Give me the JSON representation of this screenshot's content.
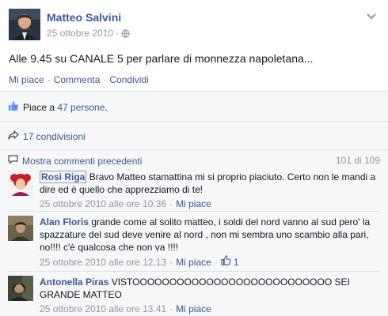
{
  "post": {
    "author": "Matteo Salvini",
    "date": "25 ottobre 2010",
    "message": "Alle 9.45 su CANALE 5 per parlare di monnezza napoletana...",
    "actions": [
      "Mi piace",
      "Commenta",
      "Condividi"
    ]
  },
  "likes": {
    "prefix": "Piace a ",
    "count": "47 persone",
    "suffix": "."
  },
  "shares": {
    "text": "17 condivisioni"
  },
  "comments_header": {
    "link": "Mostra commenti precedenti",
    "count": "101 di 109"
  },
  "comments": [
    {
      "name": "Rosi Riga",
      "text": "Bravo Matteo stamattina mi si proprio piaciuto. Certo non le mandi a dire ed è quello che apprezziamo di te!",
      "time": "25 ottobre 2010 alle ore 10.36",
      "like": "Mi piace"
    },
    {
      "name": "Alan Floris",
      "text": "grande come al solito matteo, i soldi del nord vanno al sud pero' la spazzature del sud deve venire al nord , non mi sembra uno scambio alla pari, no!!!! c'è qualcosa che non va !!!!",
      "time": "25 ottobre 2010 alle ore 12.13",
      "like": "Mi piace",
      "like_count": "1"
    },
    {
      "name": "Antonella Piras",
      "text": "VISTOOOOOOOOOOOOOOOOOOOOOOOOOOO SEI GRANDE MATTEO",
      "time": "25 ottobre 2010 alle ore 13.41",
      "like": "Mi piace"
    }
  ],
  "icons": {
    "globe": "globe-icon",
    "chevron": "chevron-down-icon",
    "thumb": "thumbs-up-icon",
    "share": "share-arrow-icon",
    "comment": "comment-bubble-icon"
  },
  "colors": {
    "link": "#3b5998",
    "meta": "#9197a3",
    "panel": "#f6f7f8",
    "border": "#e1e2e3"
  }
}
